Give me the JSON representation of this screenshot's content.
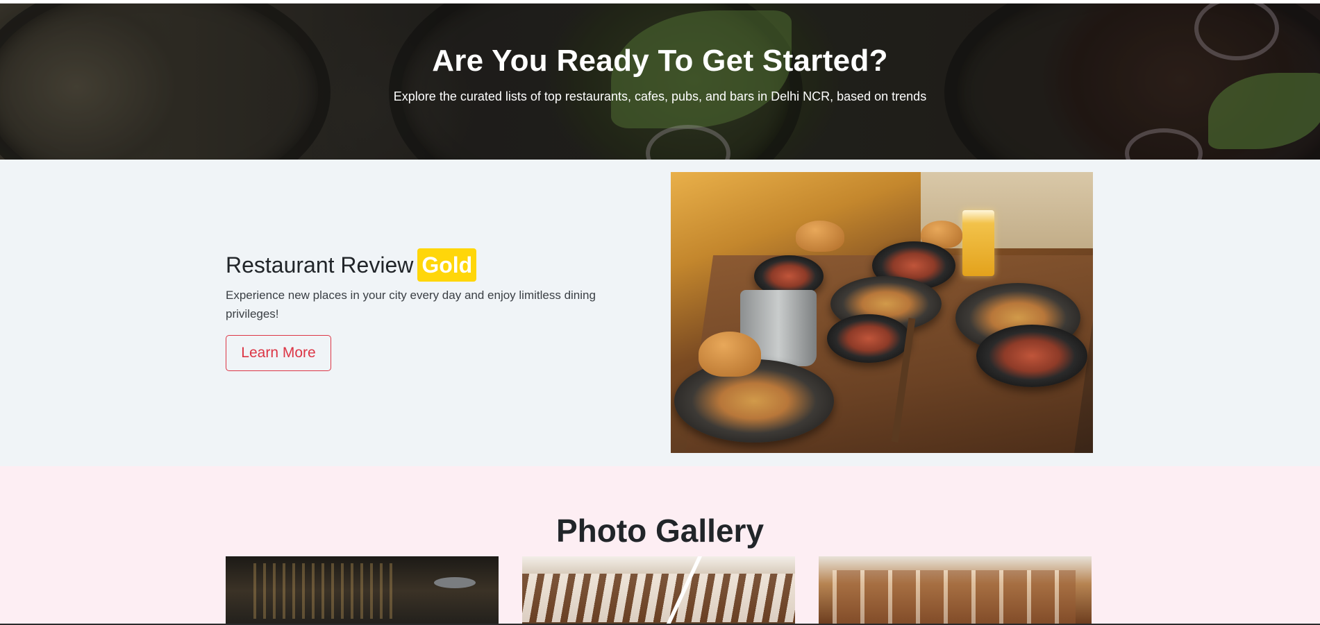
{
  "hero": {
    "title": "Are You Ready To Get Started?",
    "subtitle": "Explore the curated lists of top restaurants, cafes, pubs, and bars in Delhi NCR, based on trends"
  },
  "gold_section": {
    "heading": "Restaurant Review",
    "badge": "Gold",
    "description": "Experience new places in your city every day and enjoy limitless dining privileges!",
    "button_label": "Learn More",
    "colors": {
      "badge": "#ffd60a",
      "button": "#dc3545",
      "background": "#f0f4f7"
    }
  },
  "gallery": {
    "title": "Photo Gallery",
    "background": "#fdeef3",
    "photos": [
      "restaurant-interior-dark",
      "restaurant-interior-slatted-ceiling",
      "restaurant-interior-windows"
    ]
  }
}
